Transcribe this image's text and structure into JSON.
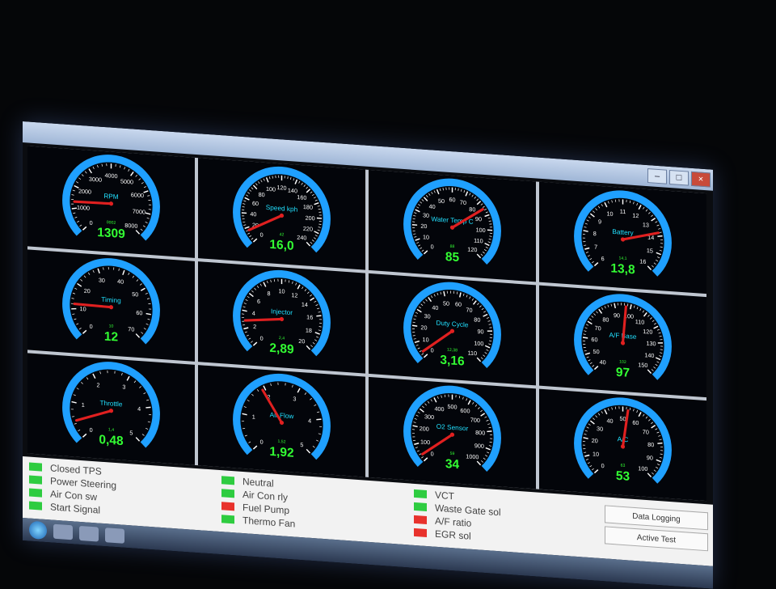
{
  "window": {
    "title": ""
  },
  "colors": {
    "ring": "#1fa0ff",
    "needle": "#e02020",
    "value": "#33ff33",
    "label": "#22e0ff",
    "tick": "#ffffff",
    "led_green": "#2ecc40",
    "led_red": "#e8322c"
  },
  "gauges": [
    {
      "label": "RPM",
      "ticks": [
        "0",
        "1000",
        "2000",
        "3000",
        "4000",
        "5000",
        "6000",
        "7000",
        "8000"
      ],
      "min": 0,
      "max": 8000,
      "value": 1309,
      "value_text": "1309",
      "sub_text": "0002"
    },
    {
      "label": "Speed kph",
      "ticks": [
        "0",
        "20",
        "40",
        "60",
        "80",
        "100",
        "120",
        "140",
        "160",
        "180",
        "200",
        "220",
        "240"
      ],
      "min": 0,
      "max": 240,
      "value": 16,
      "value_text": "16,0",
      "sub_text": "42"
    },
    {
      "label": "Water Temp C",
      "ticks": [
        "0",
        "10",
        "20",
        "30",
        "40",
        "50",
        "60",
        "70",
        "80",
        "90",
        "100",
        "110",
        "120"
      ],
      "min": 0,
      "max": 120,
      "value": 85,
      "value_text": "85",
      "sub_text": "88"
    },
    {
      "label": "Battery",
      "ticks": [
        "6",
        "7",
        "8",
        "9",
        "10",
        "11",
        "12",
        "13",
        "14",
        "15",
        "16"
      ],
      "min": 6,
      "max": 16,
      "value": 13.8,
      "value_text": "13,8",
      "sub_text": "14,1"
    },
    {
      "label": "Timing",
      "ticks": [
        "0",
        "10",
        "20",
        "30",
        "40",
        "50",
        "60",
        "70"
      ],
      "min": 0,
      "max": 70,
      "value": 12,
      "value_text": "12",
      "sub_text": "10"
    },
    {
      "label": "Injector",
      "ticks": [
        "0",
        "2",
        "4",
        "6",
        "8",
        "10",
        "12",
        "14",
        "16",
        "18",
        "20"
      ],
      "min": 0,
      "max": 20,
      "value": 2.89,
      "value_text": "2,89",
      "sub_text": "2,4"
    },
    {
      "label": "Duty Cycle",
      "ticks": [
        "0",
        "10",
        "20",
        "30",
        "40",
        "50",
        "60",
        "70",
        "80",
        "90",
        "100",
        "110"
      ],
      "min": 0,
      "max": 110,
      "value": 3.16,
      "value_text": "3,16",
      "sub_text": "12,38"
    },
    {
      "label": "A/F Base",
      "ticks": [
        "40",
        "50",
        "60",
        "70",
        "80",
        "90",
        "100",
        "110",
        "120",
        "130",
        "140",
        "150"
      ],
      "min": 40,
      "max": 150,
      "value": 97,
      "value_text": "97",
      "sub_text": "102"
    },
    {
      "label": "Throttle",
      "ticks": [
        "0",
        "1",
        "2",
        "3",
        "4",
        "5"
      ],
      "min": 0,
      "max": 5,
      "value": 0.48,
      "value_text": "0,48",
      "sub_text": "1,4"
    },
    {
      "label": "Air Flow",
      "ticks": [
        "0",
        "1",
        "2",
        "3",
        "4",
        "5"
      ],
      "min": 0,
      "max": 5,
      "value": 1.92,
      "value_text": "1,92",
      "sub_text": "1,52"
    },
    {
      "label": "O2 Sensor",
      "ticks": [
        "0",
        "100",
        "200",
        "300",
        "400",
        "500",
        "600",
        "700",
        "800",
        "900",
        "1000"
      ],
      "min": 0,
      "max": 1000,
      "value": 34,
      "value_text": "34",
      "sub_text": "59"
    },
    {
      "label": "A/C",
      "ticks": [
        "0",
        "10",
        "20",
        "30",
        "40",
        "50",
        "60",
        "70",
        "80",
        "90",
        "100"
      ],
      "min": 0,
      "max": 100,
      "value": 53,
      "value_text": "53",
      "sub_text": "63"
    }
  ],
  "status": {
    "col1": [
      {
        "label": "Closed TPS",
        "state": "green"
      },
      {
        "label": "Power Steering",
        "state": "green"
      },
      {
        "label": "Air Con sw",
        "state": "green"
      },
      {
        "label": "Start Signal",
        "state": "green"
      }
    ],
    "col2": [
      {
        "label": "Neutral",
        "state": "green"
      },
      {
        "label": "Air Con rly",
        "state": "green"
      },
      {
        "label": "Fuel Pump",
        "state": "red"
      },
      {
        "label": "Thermo Fan",
        "state": "green"
      }
    ],
    "col3": [
      {
        "label": "VCT",
        "state": "green"
      },
      {
        "label": "Waste Gate sol",
        "state": "green"
      },
      {
        "label": "A/F ratio",
        "state": "red"
      },
      {
        "label": "EGR sol",
        "state": "red"
      }
    ],
    "buttons": {
      "data_logging": "Data Logging",
      "active_test": "Active Test"
    }
  },
  "taskbar": {
    "clock_time": "",
    "clock_date": ""
  }
}
